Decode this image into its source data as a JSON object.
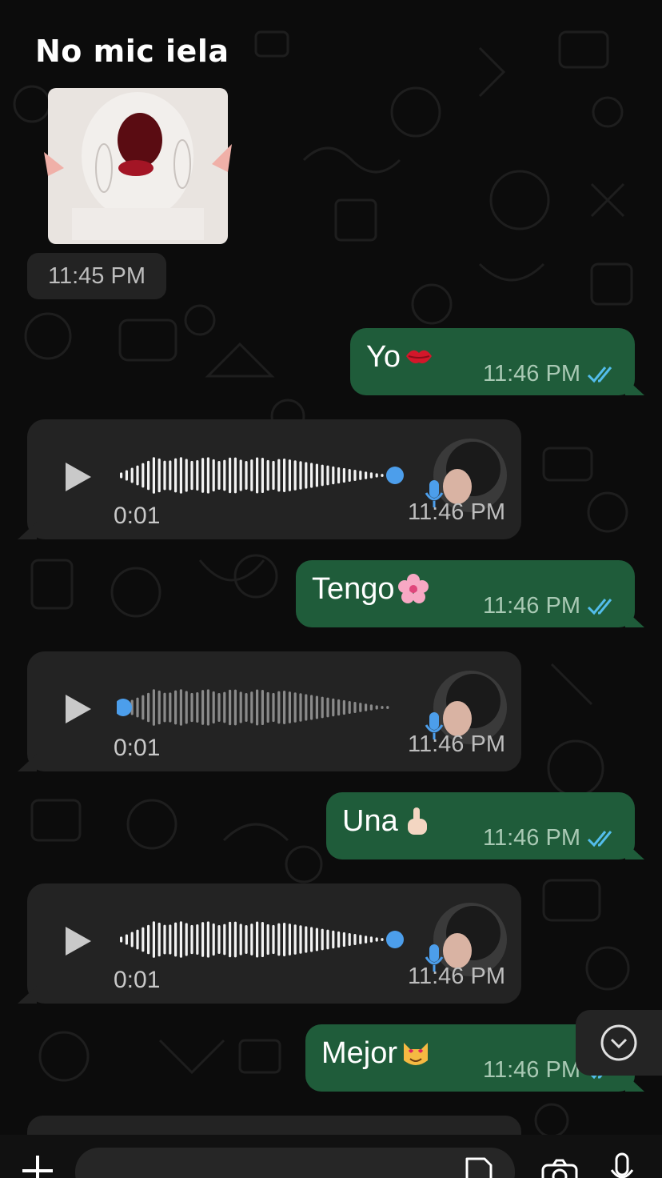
{
  "caption": "No mic iela",
  "sticker_timestamp": "11:45 PM",
  "messages": [
    {
      "kind": "out",
      "text": "Yo",
      "emoji": "kiss-mark-emoji",
      "time": "11:46 PM"
    },
    {
      "kind": "voice",
      "duration": "0:01",
      "time": "11:46 PM",
      "progress": 1.0
    },
    {
      "kind": "out",
      "text": "Tengo",
      "emoji": "cherry-blossom-emoji",
      "time": "11:46 PM"
    },
    {
      "kind": "voice",
      "duration": "0:01",
      "time": "11:46 PM",
      "progress": 0.0
    },
    {
      "kind": "out",
      "text": "Una",
      "emoji": "pointing-up-emoji",
      "time": "11:46 PM"
    },
    {
      "kind": "voice",
      "duration": "0:01",
      "time": "11:46 PM",
      "progress": 1.0
    },
    {
      "kind": "out",
      "text": "Mejor",
      "emoji": "heart-eyes-cat-emoji",
      "time": "11:46 PM"
    }
  ],
  "colors": {
    "outgoing_bubble": "#1f5c3a",
    "incoming_bubble": "#232323",
    "read_ticks": "#53bdeb",
    "playhead": "#4c9eeb"
  },
  "composer": {
    "value": ""
  }
}
